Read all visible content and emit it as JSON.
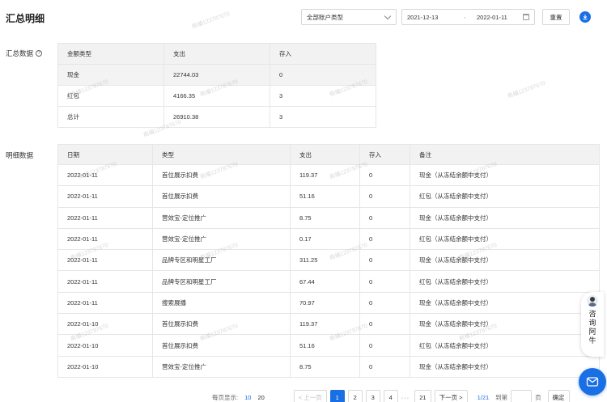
{
  "page": {
    "title": "汇总明细"
  },
  "toolbar": {
    "account_type": "全部账户类型",
    "date_start": "2021-12-13",
    "date_sep": "-",
    "date_end": "2022-01-11",
    "reset_label": "重置"
  },
  "summary": {
    "label": "汇总数据",
    "help": "?",
    "headers": [
      "金额类型",
      "支出",
      "存入"
    ],
    "rows": [
      {
        "type": "现金",
        "out": "22744.03",
        "in": "0"
      },
      {
        "type": "红包",
        "out": "4166.35",
        "in": "3"
      },
      {
        "type": "总计",
        "out": "26910.38",
        "in": "3"
      }
    ]
  },
  "detail": {
    "label": "明细数据",
    "headers": [
      "日期",
      "类型",
      "支出",
      "存入",
      "备注"
    ],
    "rows": [
      {
        "date": "2022-01-11",
        "type": "首位展示扣费",
        "out": "119.37",
        "in": "0",
        "note": "现金（从冻结余额中支付）"
      },
      {
        "date": "2022-01-11",
        "type": "首位展示扣费",
        "out": "51.16",
        "in": "0",
        "note": "红包（从冻结余额中支付）"
      },
      {
        "date": "2022-01-11",
        "type": "营效宝-定位推广",
        "out": "8.75",
        "in": "0",
        "note": "现金（从冻结余额中支付）"
      },
      {
        "date": "2022-01-11",
        "type": "营效宝-定位推广",
        "out": "0.17",
        "in": "0",
        "note": "红包（从冻结余额中支付）"
      },
      {
        "date": "2022-01-11",
        "type": "品牌专区和明星工厂",
        "out": "311.25",
        "in": "0",
        "note": "现金（从冻结余额中支付）"
      },
      {
        "date": "2022-01-11",
        "type": "品牌专区和明星工厂",
        "out": "67.44",
        "in": "0",
        "note": "红包（从冻结余额中支付）"
      },
      {
        "date": "2022-01-11",
        "type": "搜索展播",
        "out": "70.97",
        "in": "0",
        "note": "现金（从冻结余额中支付）"
      },
      {
        "date": "2022-01-10",
        "type": "首位展示扣费",
        "out": "119.37",
        "in": "0",
        "note": "现金（从冻结余额中支付）"
      },
      {
        "date": "2022-01-10",
        "type": "首位展示扣费",
        "out": "51.16",
        "in": "0",
        "note": "红包（从冻结余额中支付）"
      },
      {
        "date": "2022-01-10",
        "type": "营效宝-定位推广",
        "out": "8.75",
        "in": "0",
        "note": "现金（从冻结余额中支付）"
      }
    ]
  },
  "pager": {
    "page_size_label": "每页显示:",
    "page_sizes": [
      "10",
      "20"
    ],
    "active_page_size": "10",
    "prev": "< 上一页",
    "pages": [
      "1",
      "2",
      "3",
      "4"
    ],
    "active_page": "1",
    "ellipsis": "···",
    "last_page": "21",
    "next": "下一页 >",
    "total": "1/21",
    "goto_label": "到第",
    "page_unit": "页",
    "confirm": "确定"
  },
  "float_help": {
    "label": "咨询阿牛"
  },
  "watermark": {
    "text": "商编123787670"
  },
  "colors": {
    "primary": "#1a6fe5",
    "header_bg": "#f2f2f2",
    "border": "#e6e6e6"
  }
}
